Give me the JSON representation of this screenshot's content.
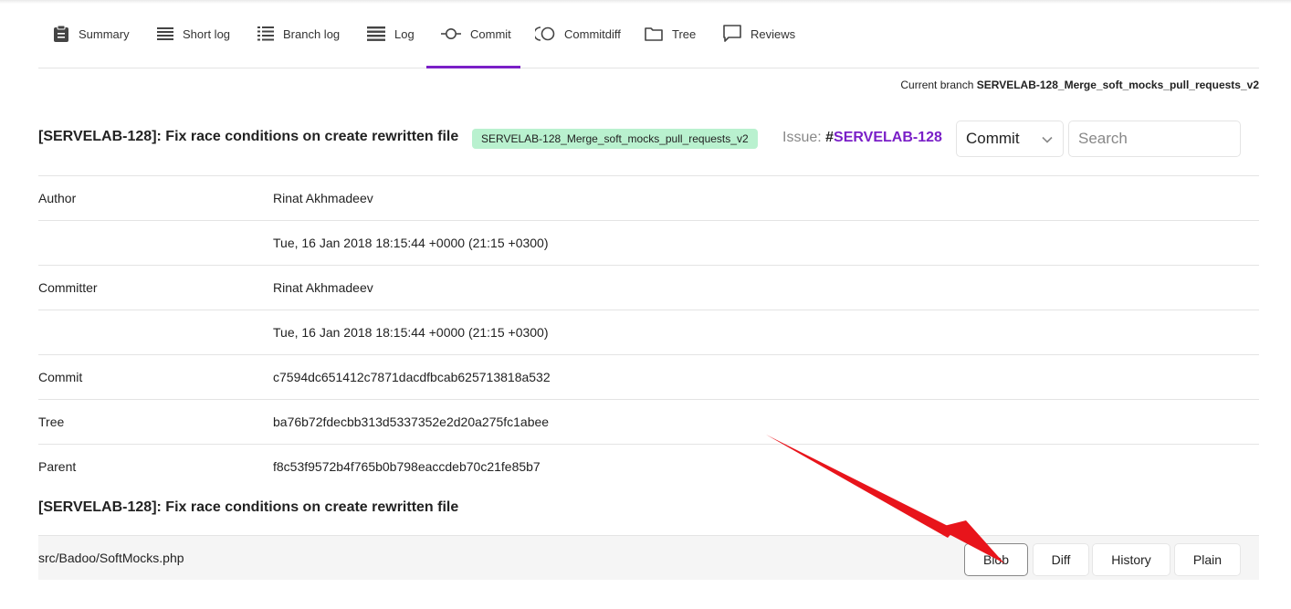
{
  "nav": {
    "tabs": [
      {
        "label": "Summary",
        "icon": "clipboard-icon"
      },
      {
        "label": "Short log",
        "icon": "short-log-icon"
      },
      {
        "label": "Branch log",
        "icon": "branch-log-icon"
      },
      {
        "label": "Log",
        "icon": "log-icon"
      },
      {
        "label": "Commit",
        "icon": "commit-icon",
        "active": true
      },
      {
        "label": "Commitdiff",
        "icon": "commitdiff-icon"
      },
      {
        "label": "Tree",
        "icon": "folder-icon"
      },
      {
        "label": "Reviews",
        "icon": "speech-bubble-icon"
      }
    ]
  },
  "current_branch": {
    "label": "Current branch",
    "name": "SERVELAB-128_Merge_soft_mocks_pull_requests_v2"
  },
  "header": {
    "title": "[SERVELAB-128]: Fix race conditions on create rewritten file",
    "branch_badge": "SERVELAB-128_Merge_soft_mocks_pull_requests_v2",
    "issue_label": "Issue:",
    "issue_hash": "#",
    "issue_id": "SERVELAB-128",
    "select_value": "Commit",
    "search_placeholder": "Search"
  },
  "info": [
    {
      "key": "Author",
      "value": "Rinat Akhmadeev"
    },
    {
      "key": "",
      "value": "Tue, 16 Jan 2018 18:15:44 +0000 (21:15 +0300)"
    },
    {
      "key": "Committer",
      "value": "Rinat Akhmadeev"
    },
    {
      "key": "",
      "value": "Tue, 16 Jan 2018 18:15:44 +0000 (21:15 +0300)"
    },
    {
      "key": "Commit",
      "value": "c7594dc651412c7871dacdfbcab625713818a532"
    },
    {
      "key": "Tree",
      "value": "ba76b72fdecbb313d5337352e2d20a275fc1abee"
    },
    {
      "key": "Parent",
      "value": "f8c53f9572b4f765b0b798eaccdeb70c21fe85b7"
    }
  ],
  "message": "[SERVELAB-128]: Fix race conditions on create rewritten file",
  "file": {
    "path": "src/Badoo/SoftMocks.php",
    "buttons": {
      "blob": "Blob",
      "diff": "Diff",
      "history": "History",
      "plain": "Plain"
    }
  },
  "colors": {
    "accent": "#7a1fc7",
    "badge": "#b9f1cf",
    "arrow": "#e8141b"
  }
}
